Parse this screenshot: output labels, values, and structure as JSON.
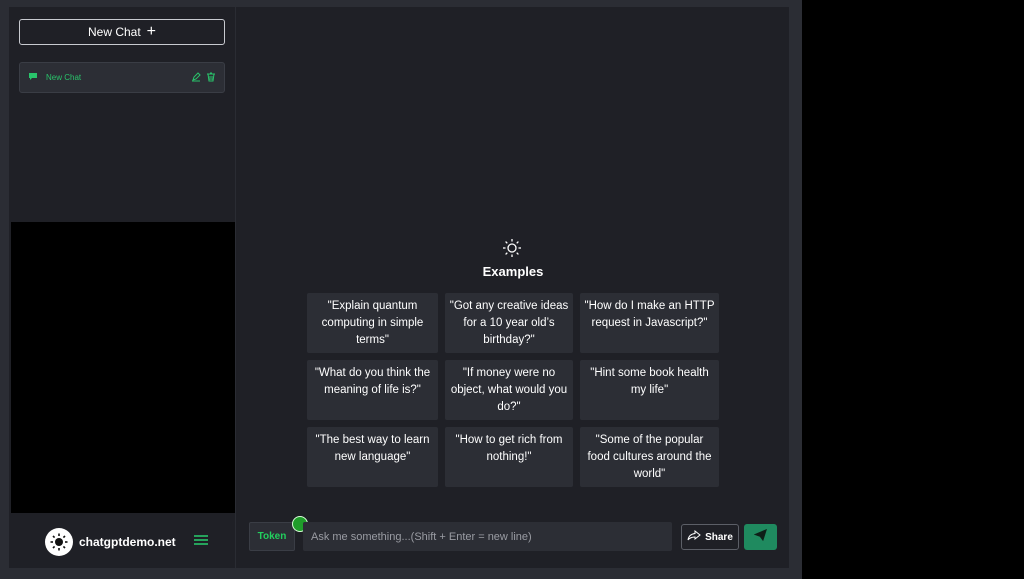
{
  "sidebar": {
    "new_chat_label": "New Chat",
    "chats": [
      {
        "label": "New Chat"
      }
    ],
    "site_name": "chatgptdemo.net"
  },
  "examples": {
    "title": "Examples",
    "items": [
      "\"Explain quantum computing in simple terms\"",
      "\"Got any creative ideas for a 10 year old’s birthday?\"",
      "\"How do I make an HTTP request in Javascript?\"",
      "\"What do you think the meaning of life is?\"",
      "\"If money were no object, what would you do?\"",
      "\"Hint some book health my life\"",
      "\"The best way to learn new language\"",
      "\"How to get rich from nothing!\"",
      "\"Some of the popular food cultures around the world\""
    ]
  },
  "composer": {
    "token_label": "Token",
    "placeholder": "Ask me something...(Shift + Enter = new line)",
    "share_label": "Share"
  },
  "colors": {
    "accent_green": "#29c46b",
    "send_button": "#1f8a5f",
    "panel_bg": "#1f2026",
    "card_bg": "#2c2e35"
  },
  "icons": {
    "chat_item": "chat-bubble-icon",
    "edit": "pencil-icon",
    "delete": "trash-icon",
    "logo": "sun-icon",
    "menu": "hamburger-icon",
    "examples": "sun-icon",
    "share": "share-arrow-icon",
    "send": "paper-plane-icon"
  }
}
